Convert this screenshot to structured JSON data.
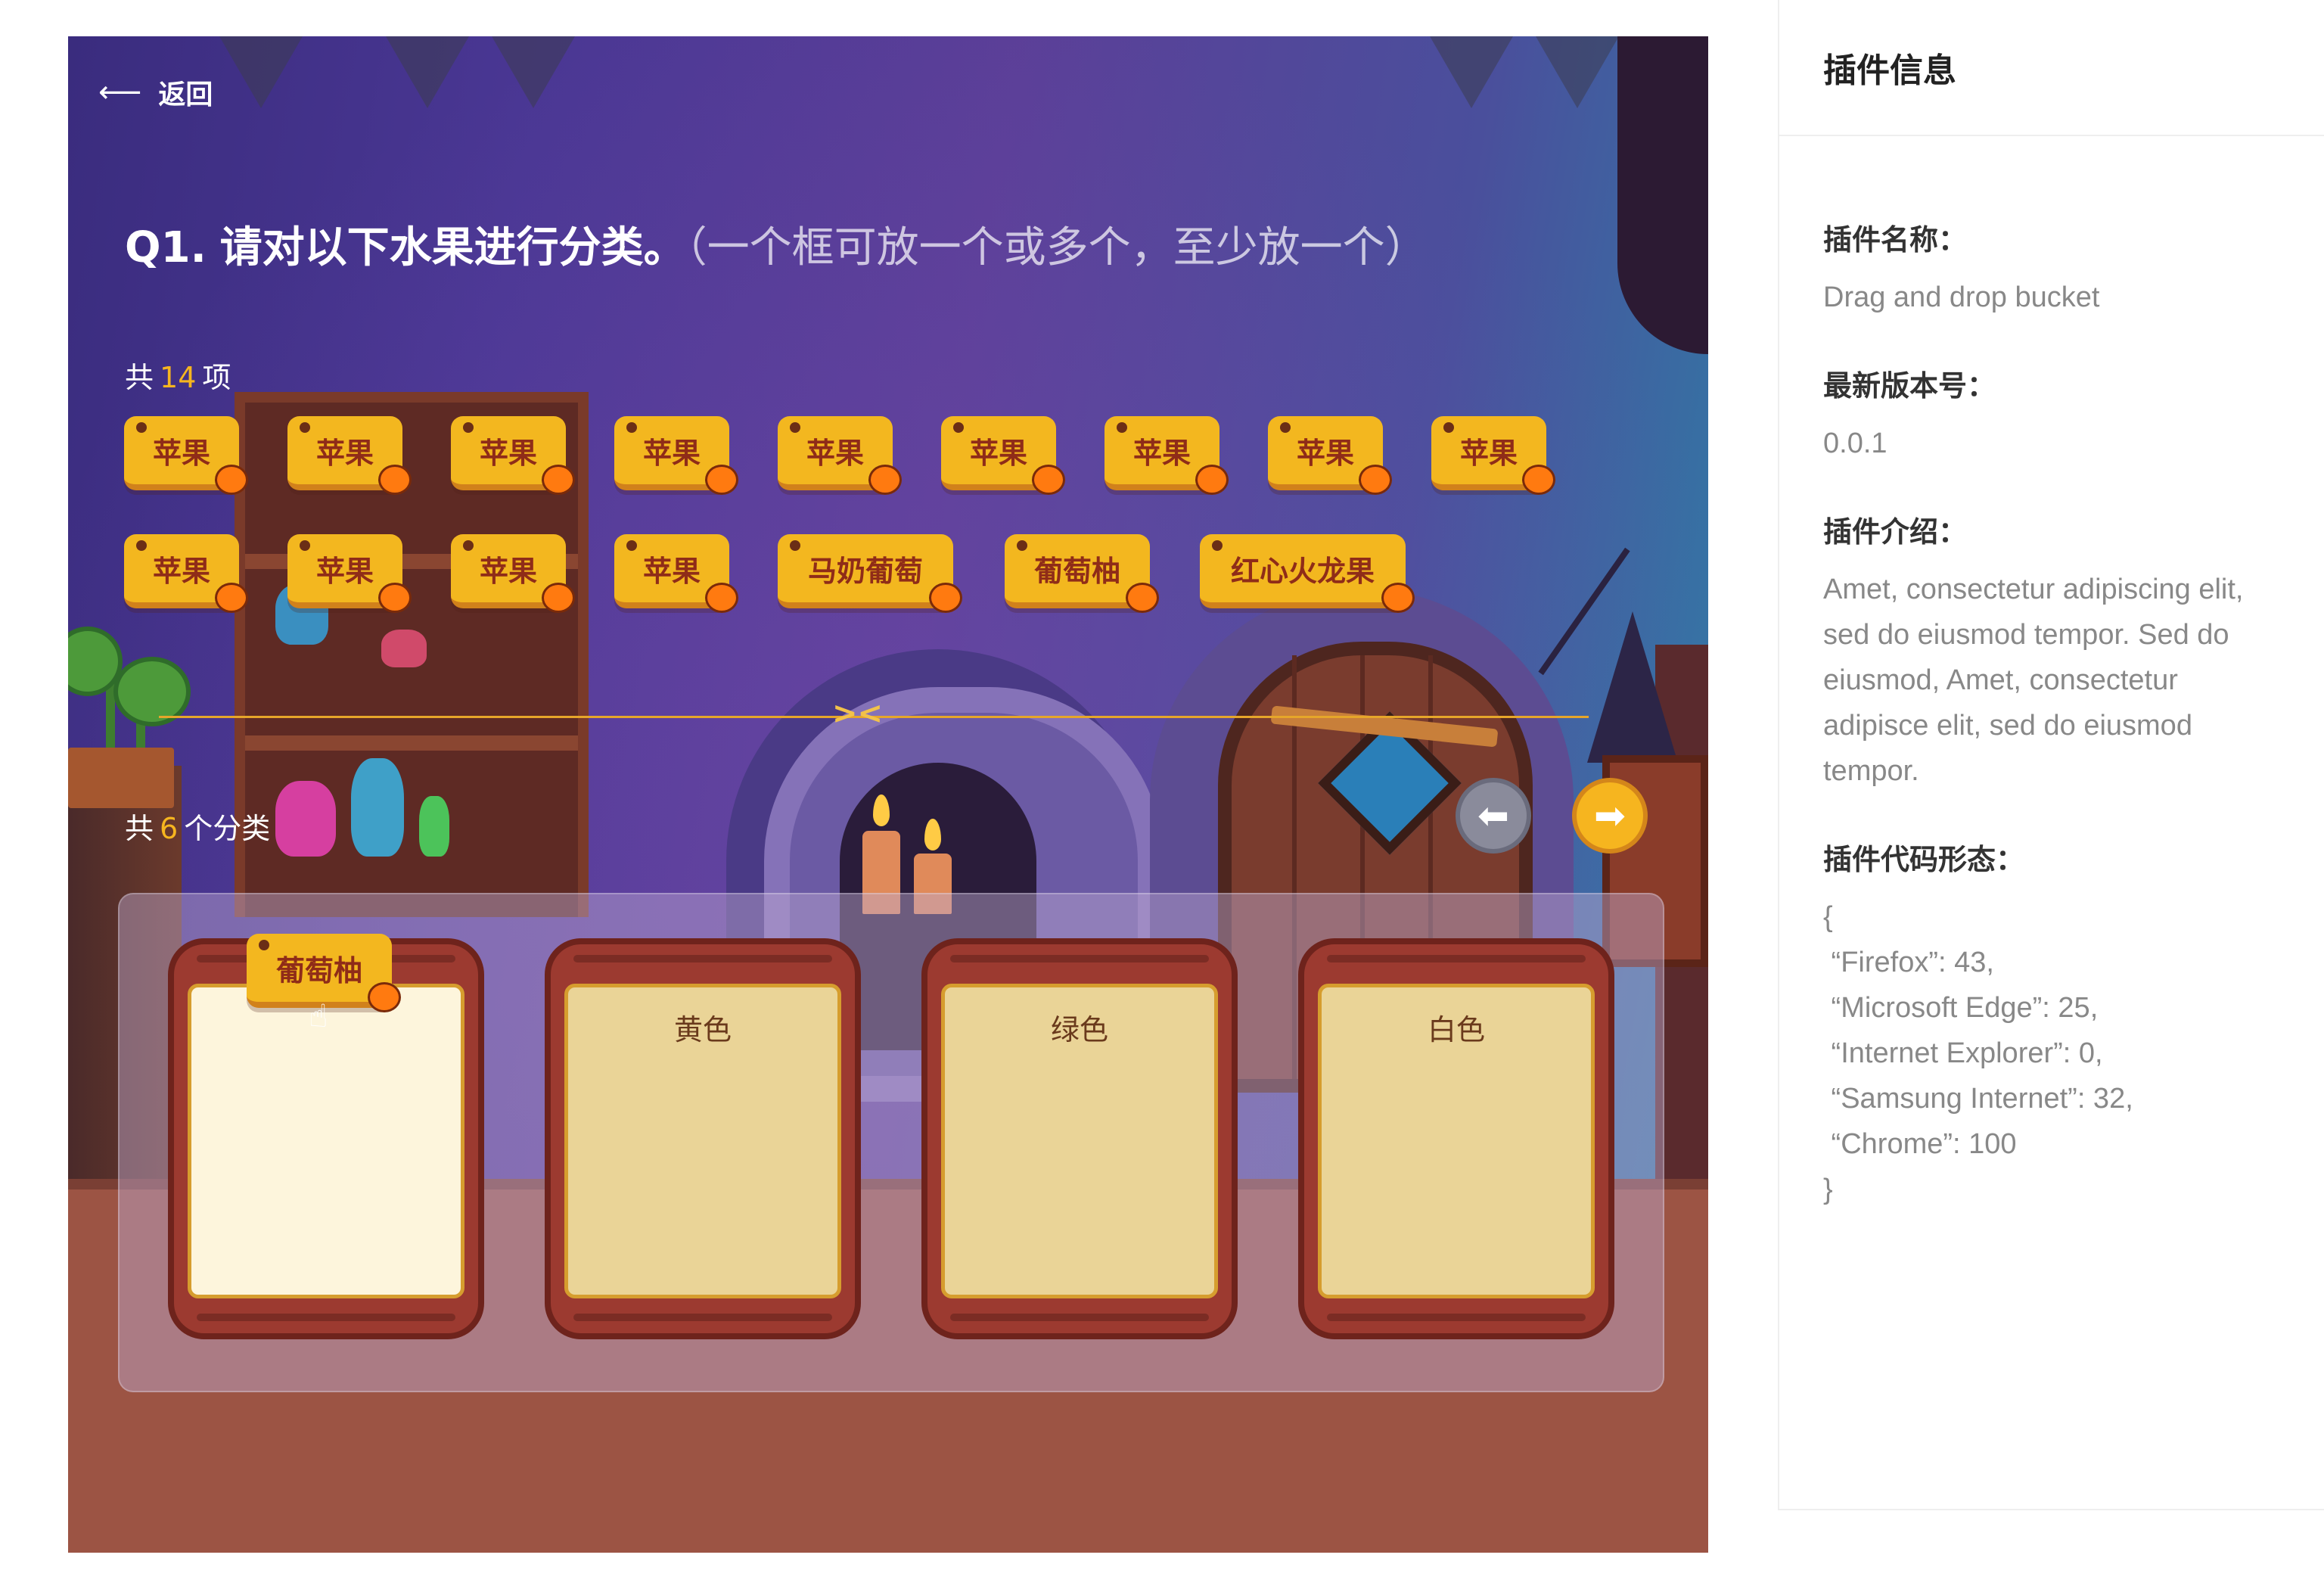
{
  "nav": {
    "back_label": "返回",
    "back_icon": "arrow-left-icon"
  },
  "question": {
    "number": "Q1.",
    "text": "请对以下水果进行分类。",
    "hint": "（一个框可放一个或多个，至少放一个）"
  },
  "items_count": {
    "prefix": "共",
    "count": "14",
    "suffix": "项"
  },
  "items": [
    "苹果",
    "苹果",
    "苹果",
    "苹果",
    "苹果",
    "苹果",
    "苹果",
    "苹果",
    "苹果",
    "苹果",
    "苹果",
    "苹果",
    "苹果",
    "马奶葡萄",
    "葡萄柚",
    "红心火龙果"
  ],
  "categories_count": {
    "prefix": "共",
    "count": "6",
    "suffix": "个分类"
  },
  "dragging_item": "葡萄柚",
  "buckets": [
    {
      "label": ""
    },
    {
      "label": "黄色"
    },
    {
      "label": "绿色"
    },
    {
      "label": "白色"
    }
  ],
  "pager": {
    "prev_icon": "arrow-left-icon",
    "next_icon": "arrow-right-icon"
  },
  "sidebar": {
    "title": "插件信息",
    "name_label": "插件名称：",
    "name_value": "Drag and drop bucket",
    "version_label": "最新版本号：",
    "version_value": "0.0.1",
    "intro_label": "插件介绍：",
    "intro_value": "Amet, consectetur adipiscing elit, sed do eiusmod tempor. Sed do eiusmod, Amet, consectetur adipisce elit, sed do eiusmod tempor.",
    "code_label": "插件代码形态：",
    "code_value": "{\n “Firefox”: 43,\n “Microsoft Edge”: 25,\n “Internet Explorer”: 0,\n “Samsung Internet”: 32,\n “Chrome”: 100\n}"
  },
  "colors": {
    "accent": "#f6b51f",
    "chip": "#f3b71f",
    "chip_text": "#8f2c18",
    "bucket_wood": "#9c3a30"
  }
}
